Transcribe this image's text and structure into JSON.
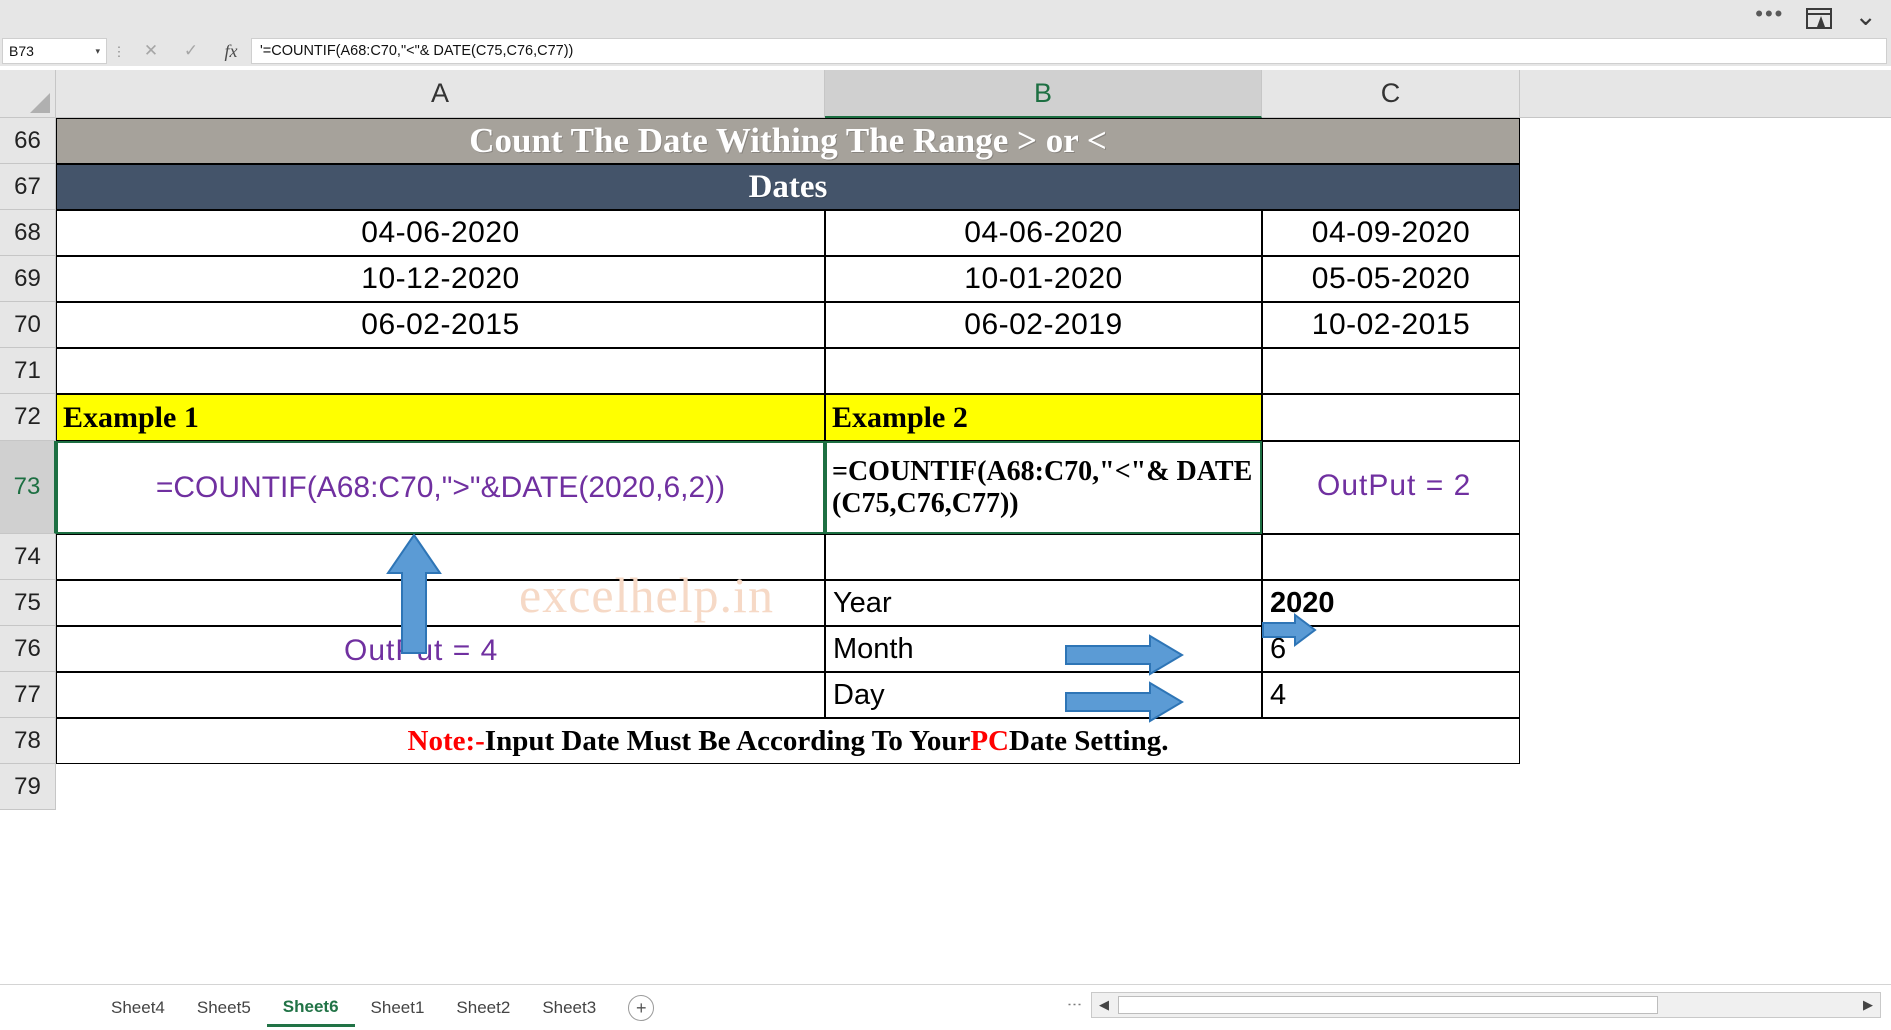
{
  "titlebar": {
    "more_icon": "•••",
    "share_icon": "share-up-icon",
    "collapse_icon": "⌄"
  },
  "formula_bar": {
    "name_box": "B73",
    "dropdown_arrow": "▾",
    "cancel_label": "✕",
    "enter_label": "✓",
    "function_label": "fx",
    "formula": "'=COUNTIF(A68:C70,\"<\"& DATE(C75,C76,C77))"
  },
  "grid": {
    "columns": [
      "A",
      "B",
      "C"
    ],
    "selected_column": "B",
    "rows": [
      "66",
      "67",
      "68",
      "69",
      "70",
      "71",
      "72",
      "73",
      "74",
      "75",
      "76",
      "77",
      "78",
      "79"
    ],
    "selected_row": "73",
    "selected_cell": "B73"
  },
  "sheet": {
    "title": "Count The Date Withing The Range > or <",
    "dates_header": "Dates",
    "dates": [
      {
        "a": "04-06-2020",
        "b": "04-06-2020",
        "c": "04-09-2020"
      },
      {
        "a": "10-12-2020",
        "b": "10-01-2020",
        "c": "05-05-2020"
      },
      {
        "a": "06-02-2015",
        "b": "06-02-2019",
        "c": "10-02-2015"
      }
    ],
    "example1_label": "Example 1",
    "example2_label": "Example 2",
    "formula_example1": "=COUNTIF(A68:C70,\">\"&DATE(2020,6,2))",
    "formula_example2": "=COUNTIF(A68:C70,\"<\"& DATE(C75,C76,C77))",
    "output1": "OutPut  =  4",
    "output2": "OutPut  =  2",
    "watermark": "excelhelp.in",
    "params": [
      {
        "label": "Year",
        "value": "2020"
      },
      {
        "label": "Month",
        "value": "6"
      },
      {
        "label": "Day",
        "value": "4"
      }
    ],
    "note": {
      "prefix": "Note:-",
      "middle": " Input Date Must Be According To Your ",
      "highlight": "PC",
      "suffix": " Date Setting."
    }
  },
  "colors": {
    "title_bg": "#a6a29b",
    "dates_bg": "#44546a",
    "example_bg": "#ffff00",
    "formula_purple": "#7030a0",
    "note_red": "#ff0000",
    "arrow_blue": "#5b9bd5",
    "selection_green": "#1d6f42",
    "watermark": "#f6d9c6"
  },
  "sheet_tabs": {
    "items": [
      {
        "label": "Sheet4",
        "active": false
      },
      {
        "label": "Sheet5",
        "active": false
      },
      {
        "label": "Sheet6",
        "active": true
      },
      {
        "label": "Sheet1",
        "active": false
      },
      {
        "label": "Sheet2",
        "active": false
      },
      {
        "label": "Sheet3",
        "active": false
      }
    ],
    "add_label": "+",
    "scroll_left": "◀",
    "scroll_right": "▶"
  }
}
